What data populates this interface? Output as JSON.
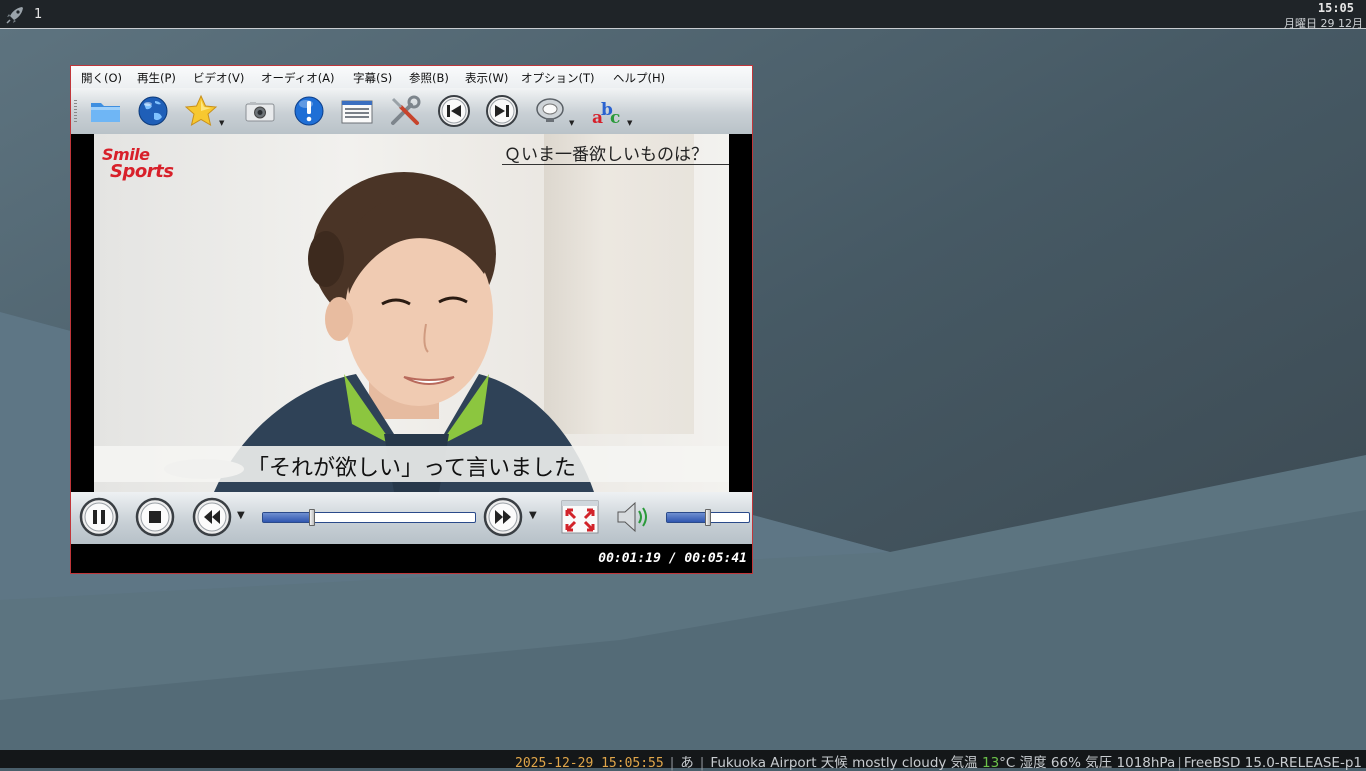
{
  "top_panel": {
    "workspace": "1",
    "time": "15:05",
    "date": "月曜日 29 12月"
  },
  "player": {
    "menu": [
      {
        "label": "開く(O)"
      },
      {
        "label": "再生(P)"
      },
      {
        "label": "ビデオ(V)"
      },
      {
        "label": "オーディオ(A)"
      },
      {
        "label": "字幕(S)"
      },
      {
        "label": "参照(B)"
      },
      {
        "label": "表示(W)"
      },
      {
        "label": "オプション(T)"
      },
      {
        "label": "ヘルプ(H)"
      }
    ],
    "toolbar_icons": [
      "folder-icon",
      "globe-icon",
      "favorites-star-icon",
      "screenshot-camera-icon",
      "info-icon",
      "playlist-icon",
      "preferences-tools-icon",
      "previous-track-icon",
      "next-track-icon",
      "audio-track-icon",
      "subtitle-abc-icon"
    ],
    "video": {
      "brand_line1": "Smile",
      "brand_line2": "Sports",
      "question": "Ｑいま一番欲しいものは？",
      "subtitle": "「それが欲しい」って言いました"
    },
    "seek_progress": 0.232,
    "volume_level": 0.5,
    "time_display": "00:01:19 / 00:05:41",
    "colors": {
      "border": "#c0363a",
      "slider": "#2f56b0"
    }
  },
  "bottom_bar": {
    "datetime": "2025-12-29 15:05:55",
    "ime": "あ",
    "weather_prefix": "Fukuoka Airport 天候  mostly cloudy  気温 ",
    "temperature": "13",
    "weather_suffix": "°C 湿度 66% 気圧 1018hPa",
    "os": "FreeBSD 15.0-RELEASE-p1"
  }
}
